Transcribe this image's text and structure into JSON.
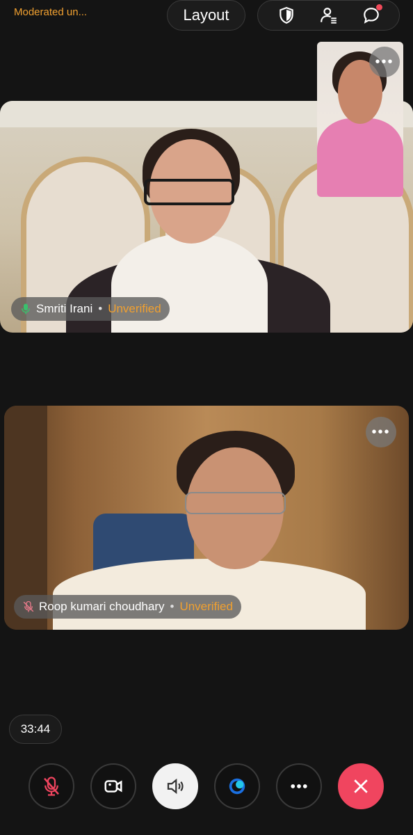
{
  "header": {
    "meeting_title": "Moderated un...",
    "layout_label": "Layout",
    "icons": [
      "shield-icon",
      "participants-icon",
      "chat-icon"
    ]
  },
  "participants": [
    {
      "name": "Smriti Irani",
      "status": "Unverified",
      "mic": "on"
    },
    {
      "name": "Roop kumari choudhary",
      "status": "Unverified",
      "mic": "muted"
    }
  ],
  "more_label": "•••",
  "timer": "33:44",
  "controls": [
    "mic-muted",
    "video",
    "speaker",
    "effects",
    "more",
    "end-call"
  ],
  "colors": {
    "accent_orange": "#f0a030",
    "hangup_red": "#f0455f",
    "mic_green": "#39c16c",
    "notification_dot": "#f04a5a"
  }
}
